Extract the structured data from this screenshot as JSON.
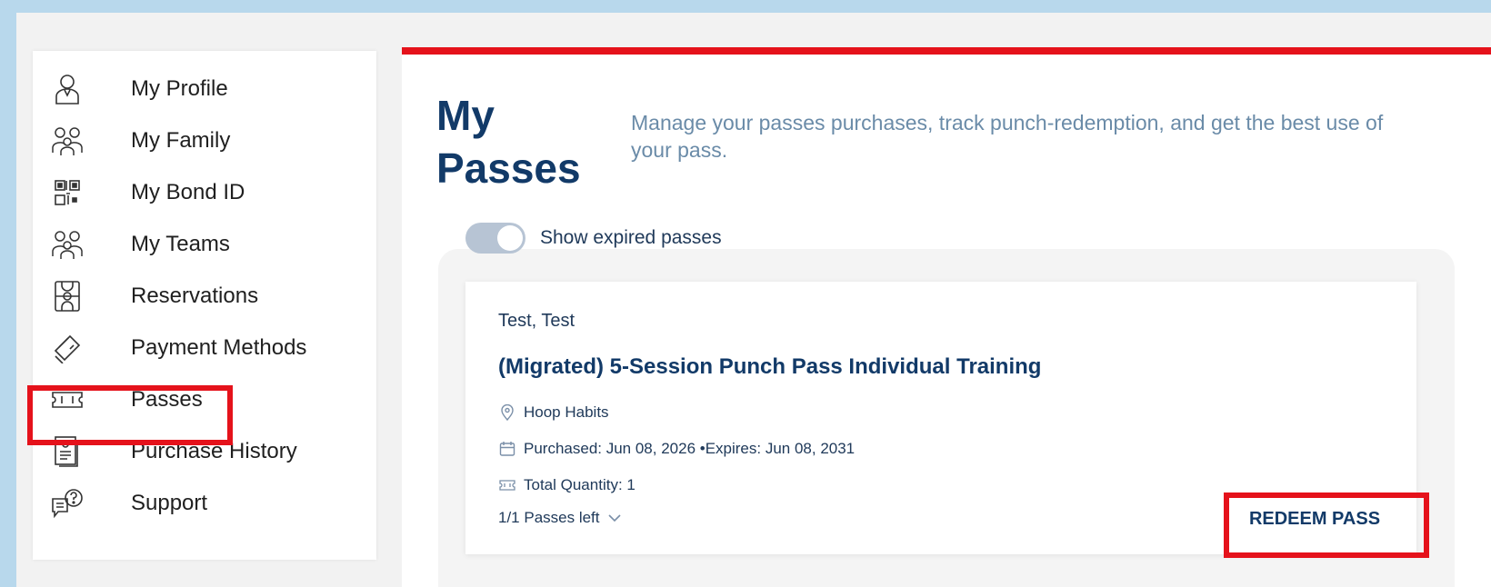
{
  "sidebar": {
    "items": [
      {
        "label": "My Profile",
        "icon": "user-icon"
      },
      {
        "label": "My Family",
        "icon": "family-icon"
      },
      {
        "label": "My Bond ID",
        "icon": "qr-code-icon"
      },
      {
        "label": "My Teams",
        "icon": "team-icon"
      },
      {
        "label": "Reservations",
        "icon": "court-icon"
      },
      {
        "label": "Payment Methods",
        "icon": "credit-card-icon"
      },
      {
        "label": "Passes",
        "icon": "ticket-icon"
      },
      {
        "label": "Purchase History",
        "icon": "receipt-icon"
      },
      {
        "label": "Support",
        "icon": "chat-help-icon"
      }
    ],
    "highlighted_item": "Passes"
  },
  "main": {
    "title_line1": "My",
    "title_line2": "Passes",
    "subtitle": "Manage your passes purchases, track punch-redemption, and get the best use of your pass.",
    "toggle": {
      "label": "Show expired passes"
    },
    "pass_card": {
      "owner": "Test, Test",
      "name": "(Migrated) 5-Session Punch Pass Individual Training",
      "location": "Hoop Habits",
      "dates": "Purchased: Jun 08, 2026 •Expires: Jun 08, 2031",
      "quantity": "Total Quantity: 1",
      "passes_left": "1/1 Passes left",
      "redeem_label": "REDEEM PASS"
    }
  },
  "colors": {
    "accent_red": "#e5121b",
    "navy": "#123a68",
    "subtitle_blue": "#6a8ba8",
    "background": "#b8d8ec"
  }
}
